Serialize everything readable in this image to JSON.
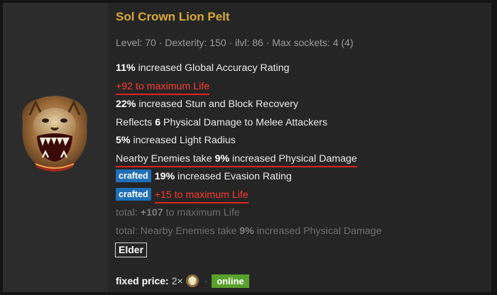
{
  "item": {
    "name": "Sol Crown Lion Pelt",
    "level": "Level: 70",
    "dexterity": "Dexterity: 150",
    "ilvl": "ilvl: 86",
    "sockets": "Max sockets: 4 (4)",
    "separator": "·"
  },
  "mods": [
    {
      "num": "11%",
      "text": " increased Global Accuracy Rating"
    },
    {
      "text": "+92 to maximum Life"
    },
    {
      "num": "22%",
      "text": " increased Stun and Block Recovery"
    },
    {
      "pre": "Reflects ",
      "num": "6",
      "text": " Physical Damage to Melee Attackers"
    },
    {
      "num": "5%",
      "text": " increased Light Radius"
    },
    {
      "pre": "Nearby Enemies take ",
      "num": "9%",
      "text": " increased Physical Damage"
    },
    {
      "badge": "crafted",
      "num": "19%",
      "text": " increased Evasion Rating"
    },
    {
      "badge": "crafted",
      "text": "+15 to maximum Life"
    }
  ],
  "totals": [
    {
      "pre": "total: ",
      "num": "+107",
      "text": " to maximum Life"
    },
    {
      "pre": "total: Nearby Enemies take ",
      "num": "9%",
      "text": " increased Physical Damage"
    }
  ],
  "influence": "Elder",
  "price": {
    "label": "fixed price:",
    "amount": "2×",
    "status": "online",
    "separator": "·"
  },
  "colors": {
    "title": "#d8a937",
    "highlight_red": "#ff3a2e",
    "crafted_badge": "#1f6fb7",
    "online_badge": "#5aa02c"
  },
  "icons": {
    "item": "lion-pelt-helmet-icon",
    "currency": "exalted-orb-icon"
  }
}
